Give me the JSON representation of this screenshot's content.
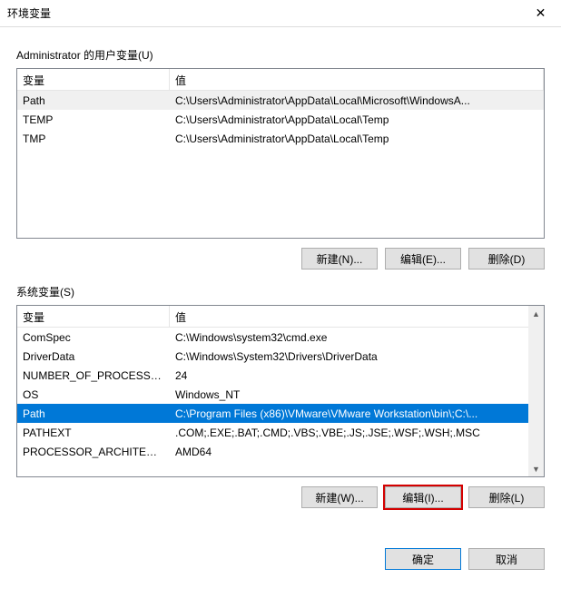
{
  "window": {
    "title": "环境变量",
    "close": "✕"
  },
  "userSection": {
    "label": "Administrator 的用户变量(U)",
    "headers": {
      "name": "变量",
      "value": "值"
    },
    "rows": [
      {
        "name": "Path",
        "value": "C:\\Users\\Administrator\\AppData\\Local\\Microsoft\\WindowsA...",
        "selected": "inactive"
      },
      {
        "name": "TEMP",
        "value": "C:\\Users\\Administrator\\AppData\\Local\\Temp"
      },
      {
        "name": "TMP",
        "value": "C:\\Users\\Administrator\\AppData\\Local\\Temp"
      }
    ],
    "buttons": {
      "new": "新建(N)...",
      "edit": "编辑(E)...",
      "delete": "删除(D)"
    }
  },
  "systemSection": {
    "label": "系统变量(S)",
    "headers": {
      "name": "变量",
      "value": "值"
    },
    "rows": [
      {
        "name": "ComSpec",
        "value": "C:\\Windows\\system32\\cmd.exe"
      },
      {
        "name": "DriverData",
        "value": "C:\\Windows\\System32\\Drivers\\DriverData"
      },
      {
        "name": "NUMBER_OF_PROCESSORS",
        "value": "24"
      },
      {
        "name": "OS",
        "value": "Windows_NT"
      },
      {
        "name": "Path",
        "value": "C:\\Program Files (x86)\\VMware\\VMware Workstation\\bin\\;C:\\...",
        "selected": "active"
      },
      {
        "name": "PATHEXT",
        "value": ".COM;.EXE;.BAT;.CMD;.VBS;.VBE;.JS;.JSE;.WSF;.WSH;.MSC"
      },
      {
        "name": "PROCESSOR_ARCHITECT...",
        "value": "AMD64"
      }
    ],
    "buttons": {
      "new": "新建(W)...",
      "edit": "编辑(I)...",
      "delete": "删除(L)"
    }
  },
  "footer": {
    "ok": "确定",
    "cancel": "取消"
  }
}
